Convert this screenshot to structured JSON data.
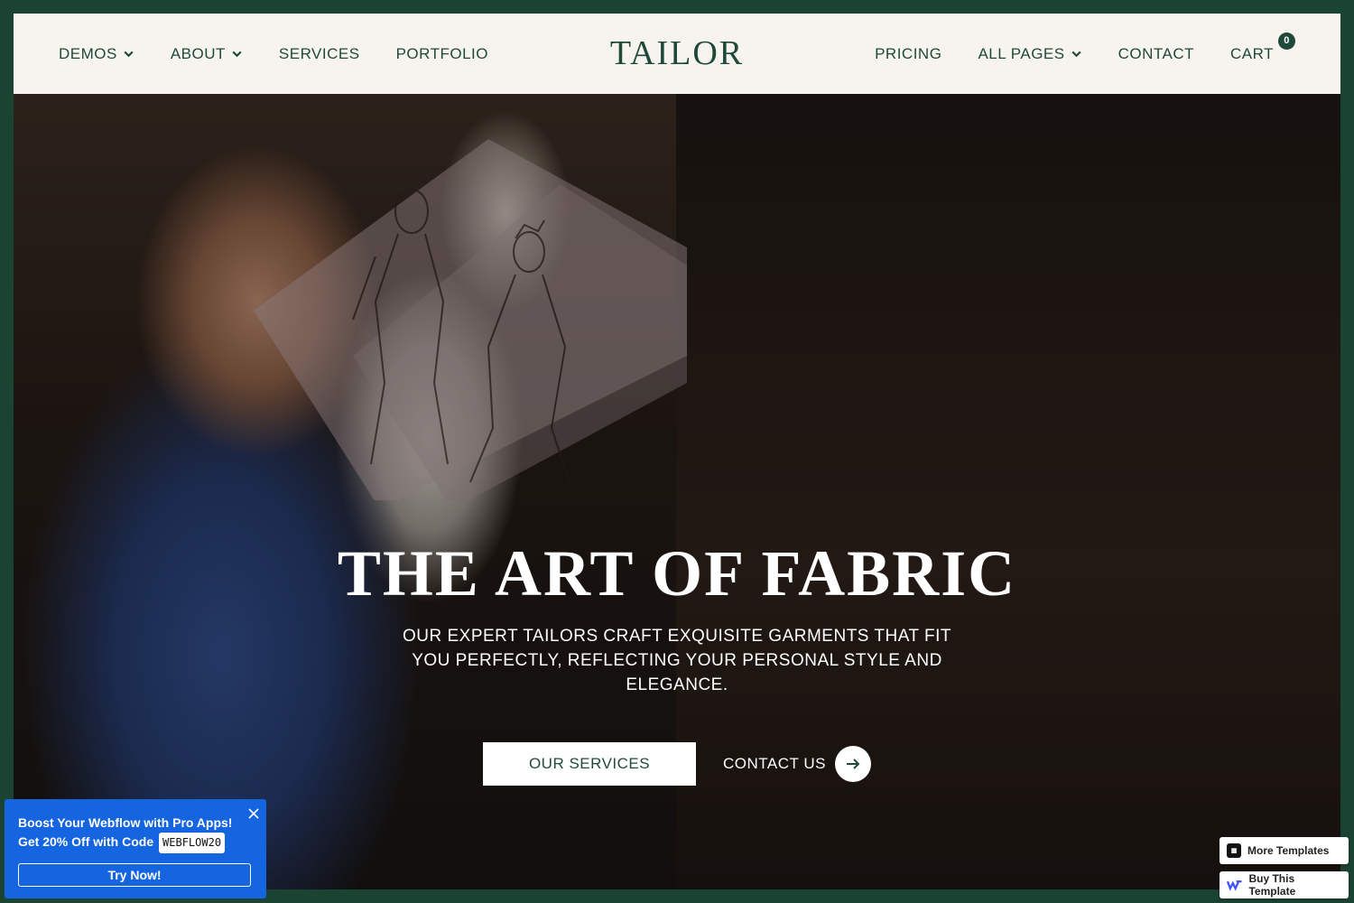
{
  "header": {
    "logo": "TAILOR",
    "nav_left": [
      {
        "label": "DEMOS",
        "dropdown": true
      },
      {
        "label": "ABOUT",
        "dropdown": true
      },
      {
        "label": "SERVICES",
        "dropdown": false
      },
      {
        "label": "PORTFOLIO",
        "dropdown": false
      }
    ],
    "nav_right": [
      {
        "label": "PRICING",
        "dropdown": false
      },
      {
        "label": "ALL PAGES",
        "dropdown": true
      },
      {
        "label": "CONTACT",
        "dropdown": false
      }
    ],
    "cart_label": "CART",
    "cart_count": "0"
  },
  "hero": {
    "title": "THE ART OF FABRIC",
    "subtitle": "OUR EXPERT TAILORS CRAFT EXQUISITE GARMENTS THAT FIT YOU PERFECTLY, REFLECTING YOUR PERSONAL STYLE AND ELEGANCE.",
    "primary_button": "OUR SERVICES",
    "secondary_button": "CONTACT US"
  },
  "promo": {
    "line1": "Boost Your Webflow with Pro Apps!",
    "line2": "Get 20% Off with Code",
    "code": "WEBFLOW20",
    "button": "Try Now!"
  },
  "badges": {
    "more_templates": "More Templates",
    "buy_template": "Buy This Template"
  },
  "colors": {
    "brand_green": "#1f4a3a",
    "page_border": "#1b4332",
    "header_bg": "#f7f3ef",
    "promo_blue": "#1565e0"
  }
}
